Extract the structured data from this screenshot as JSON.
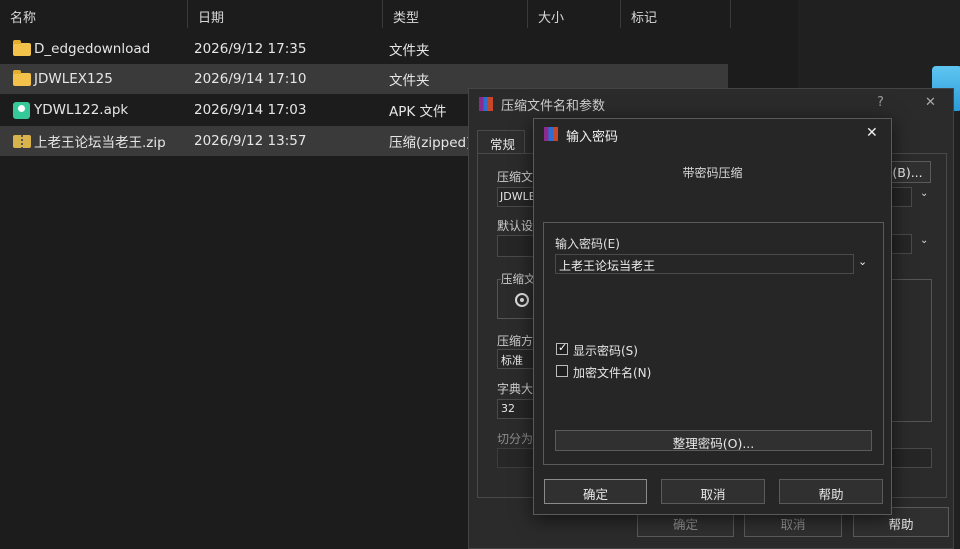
{
  "explorer": {
    "columns": [
      "名称",
      "日期",
      "类型",
      "大小",
      "标记"
    ],
    "files": [
      {
        "name": "D_edgedownload",
        "date": "2026/9/12 17:35",
        "type": "文件夹",
        "icon": "folder-icon",
        "selected": false
      },
      {
        "name": "JDWLEX125",
        "date": "2026/9/14 17:10",
        "type": "文件夹",
        "icon": "folder-icon",
        "selected": true
      },
      {
        "name": "YDWL122.apk",
        "date": "2026/9/14 17:03",
        "type": "APK 文件",
        "icon": "apk-icon",
        "selected": false
      },
      {
        "name": "上老王论坛当老王.zip",
        "date": "2026/9/12 13:57",
        "type": "压缩(zipped)",
        "icon": "zip-icon",
        "selected": true
      }
    ]
  },
  "back_dialog": {
    "title": "压缩文件名和参数",
    "help": "?",
    "close": "✕",
    "tab_general": "常规",
    "field1_label": "压缩文",
    "field1_value": "JDWLE",
    "browse_label": "(B)...",
    "field2_label": "默认设",
    "group_label": "压缩文",
    "field3_label": "压缩方",
    "field3_value": "标准",
    "field4_label": "字典大小",
    "field4_value": "32",
    "field5_label": "切分为",
    "ok": "确定",
    "cancel": "取消",
    "helpbtn": "帮助"
  },
  "password_dialog": {
    "title": "输入密码",
    "close": "✕",
    "subtitle": "带密码压缩",
    "password_label": "输入密码(E)",
    "password_value": "上老王论坛当老王",
    "show_password": "显示密码(S)",
    "show_password_checked": true,
    "encrypt_names": "加密文件名(N)",
    "encrypt_names_checked": false,
    "organize": "整理密码(O)...",
    "ok": "确定",
    "cancel": "取消",
    "help": "帮助"
  }
}
